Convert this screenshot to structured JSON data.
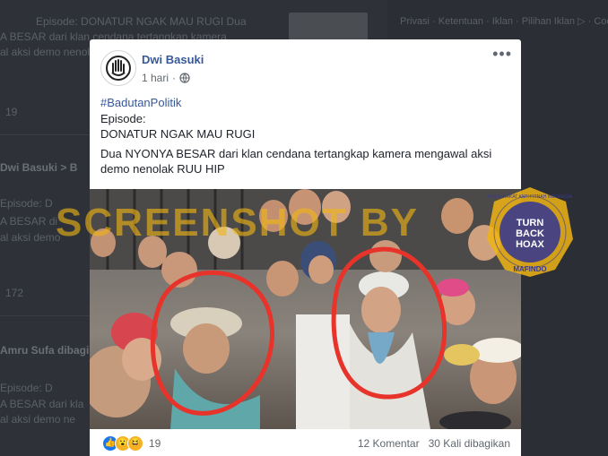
{
  "background": {
    "lines": [
      "Episode: DONATUR NGAK MAU RUGI Dua",
      "A BESAR dari klan cendana tertangkap kamera",
      "al aksi demo nenolak RUU HIP",
      "19",
      "Dwi Basuki  >  B",
      "Episode: D",
      "A BESAR di",
      "al aksi demo",
      "172",
      "Amru Sufa dibagikan",
      "Episode: D",
      "A BESAR dari kla",
      "al aksi demo ne"
    ],
    "right_links": "Privasi · Ketentuan · Iklan · Pilihan Iklan ▷ · Cookie ·"
  },
  "post": {
    "author": "Dwi Basuki",
    "time": "1 hari",
    "hashtag": "#BadutanPolitik",
    "episode_label": "Episode:",
    "episode_title": "DONATUR NGAK MAU RUGI",
    "body_line1": "Dua NYONYA BESAR dari klan cendana tertangkap kamera mengawal aksi",
    "body_line2": "demo nenolak RUU HIP",
    "reaction_count": "19",
    "comments": "12 Komentar",
    "shares": "30 Kali dibagikan"
  },
  "watermark": {
    "text": "SCREENSHOT BY",
    "badge_top": "TURN",
    "badge_mid": "BACK",
    "badge_bot": "HOAX",
    "badge_ring": "MASYARAKAT ANTI FITNAH INDONESIA",
    "badge_org": "MAFINDO"
  },
  "colors": {
    "accent": "#365899",
    "circle_red": "#e8332a",
    "watermark": "#f0b414",
    "badge_blue": "#3b3a8c"
  }
}
